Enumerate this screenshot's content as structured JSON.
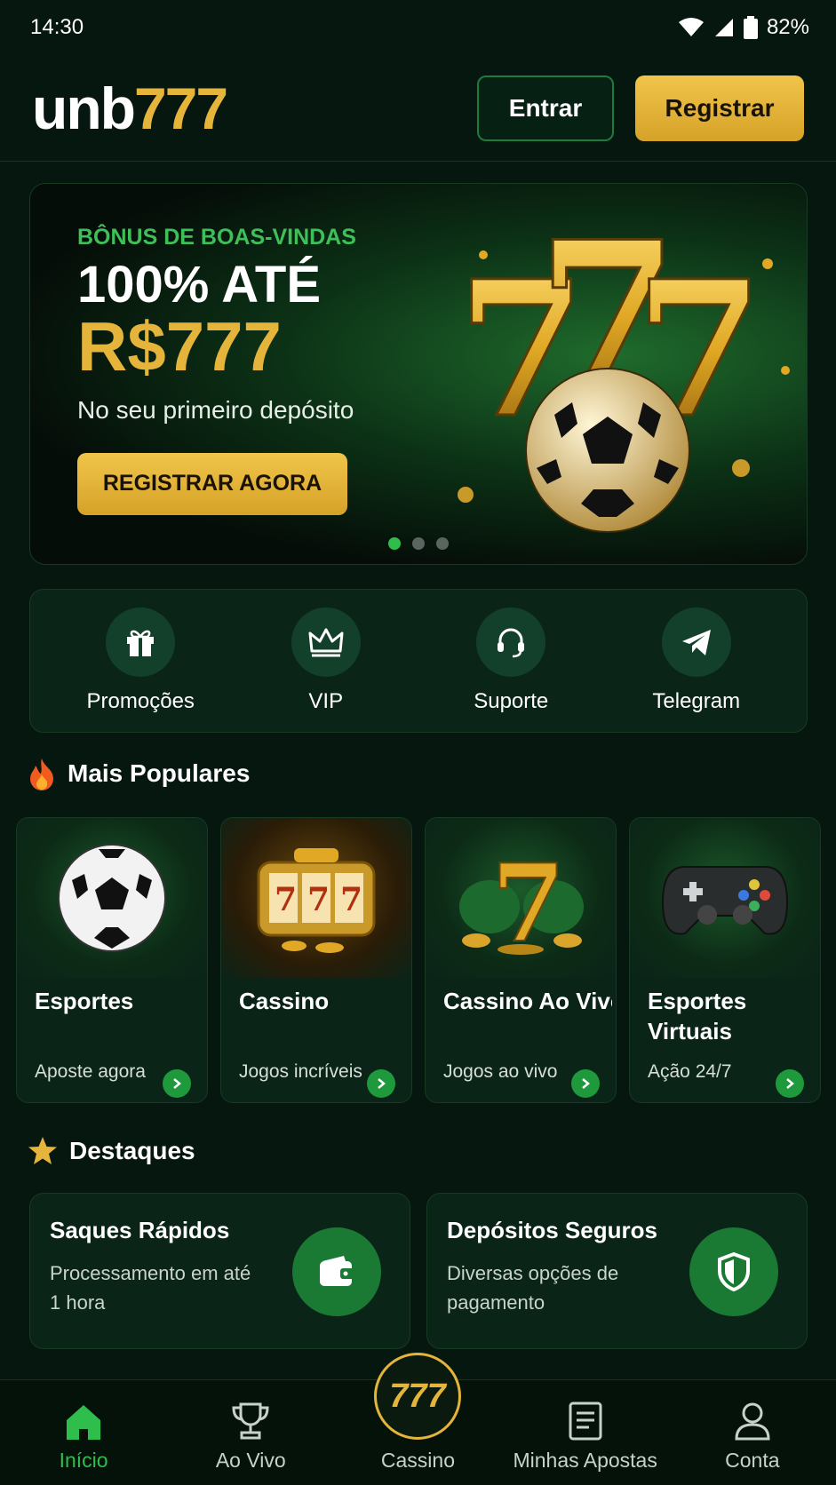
{
  "status": {
    "time": "14:30",
    "battery": "82%"
  },
  "header": {
    "logo_part1": "unb",
    "logo_part2": "777",
    "login_label": "Entrar",
    "register_label": "Registrar"
  },
  "banner": {
    "eyebrow": "BÔNUS DE BOAS-VINDAS",
    "headline": "100% ATÉ",
    "amount": "R$777",
    "subtitle": "No seu primeiro depósito",
    "cta": "REGISTRAR AGORA",
    "slides_total": 3,
    "slide_active": 1
  },
  "quick_links": [
    {
      "label": "Promoções",
      "icon": "gift-icon"
    },
    {
      "label": "VIP",
      "icon": "crown-icon"
    },
    {
      "label": "Suporte",
      "icon": "headset-icon"
    },
    {
      "label": "Telegram",
      "icon": "telegram-icon"
    }
  ],
  "popular": {
    "title": "Mais Populares",
    "icon": "fire-icon",
    "cards": [
      {
        "title": "Esportes",
        "subtitle": "Aposte agora",
        "icon": "soccer-ball-icon"
      },
      {
        "title": "Cassino",
        "subtitle": "Jogos incríveis",
        "icon": "slot-machine-icon"
      },
      {
        "title": "Cassino Ao Vivo",
        "subtitle": "Jogos ao vivo",
        "icon": "lucky-seven-icon"
      },
      {
        "title": "Esportes Virtuais",
        "subtitle": "Ação 24/7",
        "icon": "gamepad-icon"
      }
    ]
  },
  "highlights": {
    "title": "Destaques",
    "icon": "star-icon",
    "items": [
      {
        "title": "Saques Rápidos",
        "desc": "Processamento em até 1 hora",
        "icon": "wallet-icon"
      },
      {
        "title": "Depósitos Seguros",
        "desc": "Diversas opções de pagamento",
        "icon": "shield-icon"
      }
    ]
  },
  "nav": {
    "items": [
      {
        "label": "Início",
        "icon": "home-icon",
        "active": true
      },
      {
        "label": "Ao Vivo",
        "icon": "trophy-icon"
      },
      {
        "label": "Cassino",
        "icon": "777-icon"
      },
      {
        "label": "Minhas Apostas",
        "icon": "receipt-icon"
      },
      {
        "label": "Conta",
        "icon": "user-icon"
      }
    ],
    "center_badge": "777"
  },
  "colors": {
    "background": "#061710",
    "accent_gold": "#e4b43b",
    "accent_green": "#2fbd4c"
  }
}
